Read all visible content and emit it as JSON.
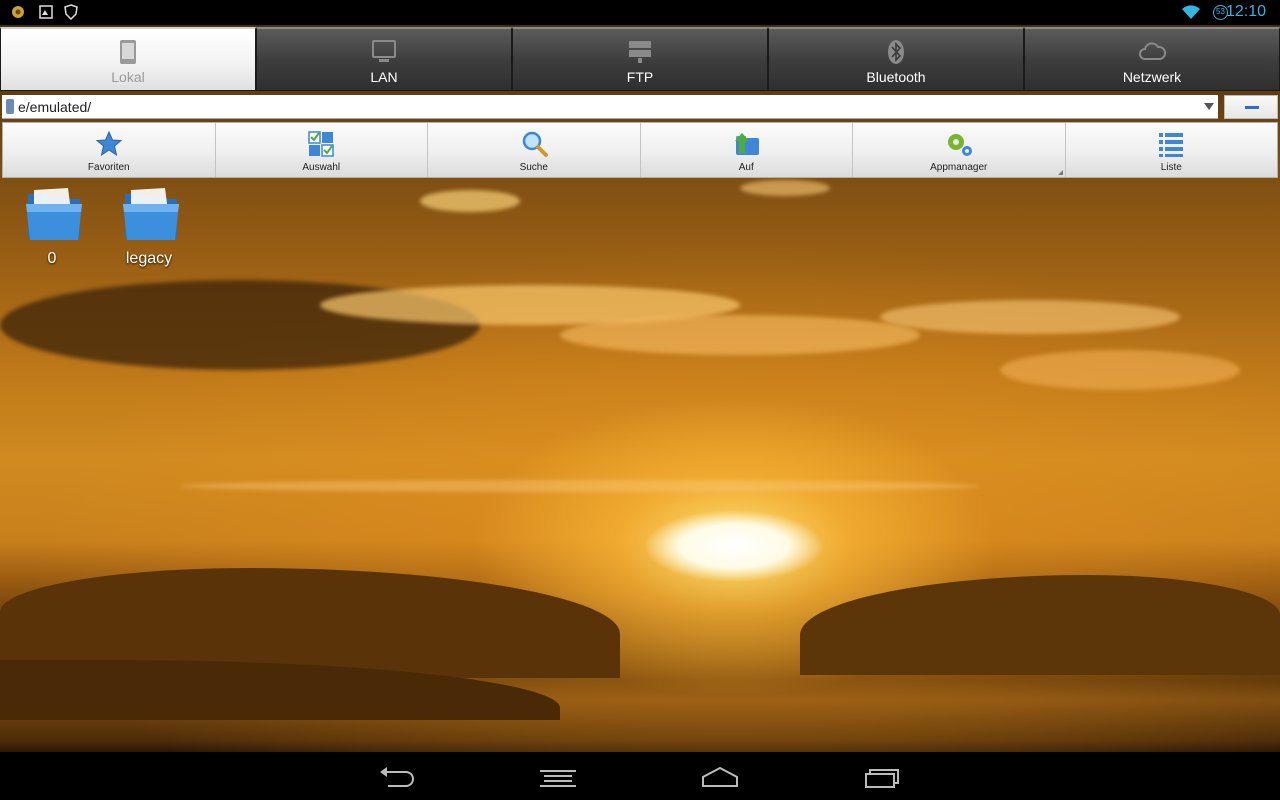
{
  "status_bar": {
    "time": "12:10",
    "badge": "53",
    "icons": [
      "notification-app-icon",
      "gallery-notification-icon",
      "shield-notification-icon",
      "wifi-icon"
    ]
  },
  "tabs": [
    {
      "label": "Lokal",
      "icon": "tablet-icon",
      "active": true
    },
    {
      "label": "LAN",
      "icon": "monitor-icon",
      "active": false
    },
    {
      "label": "FTP",
      "icon": "server-icon",
      "active": false
    },
    {
      "label": "Bluetooth",
      "icon": "bluetooth-icon",
      "active": false
    },
    {
      "label": "Netzwerk",
      "icon": "cloud-icon",
      "active": false
    }
  ],
  "path_bar": {
    "path": "e/emulated/",
    "dropdown_icon": "dropdown-arrow-icon",
    "action_icon": "minus-icon"
  },
  "toolbar": [
    {
      "label": "Favoriten",
      "icon": "star-icon"
    },
    {
      "label": "Auswahl",
      "icon": "select-grid-icon"
    },
    {
      "label": "Suche",
      "icon": "magnifier-icon"
    },
    {
      "label": "Auf",
      "icon": "folder-up-icon"
    },
    {
      "label": "Appmanager",
      "icon": "gears-icon"
    },
    {
      "label": "Liste",
      "icon": "list-icon"
    }
  ],
  "files": [
    {
      "name": "0",
      "icon": "folder-icon"
    },
    {
      "name": "legacy",
      "icon": "folder-icon"
    }
  ],
  "nav_bar": {
    "buttons": [
      "back-icon",
      "menu-icon",
      "home-icon",
      "recents-icon"
    ]
  },
  "colors": {
    "accent": "#33b5e5",
    "tab_inactive": "#3e3e3e",
    "tab_active": "#f2f2f2",
    "folder_blue": "#3c8fdc"
  }
}
